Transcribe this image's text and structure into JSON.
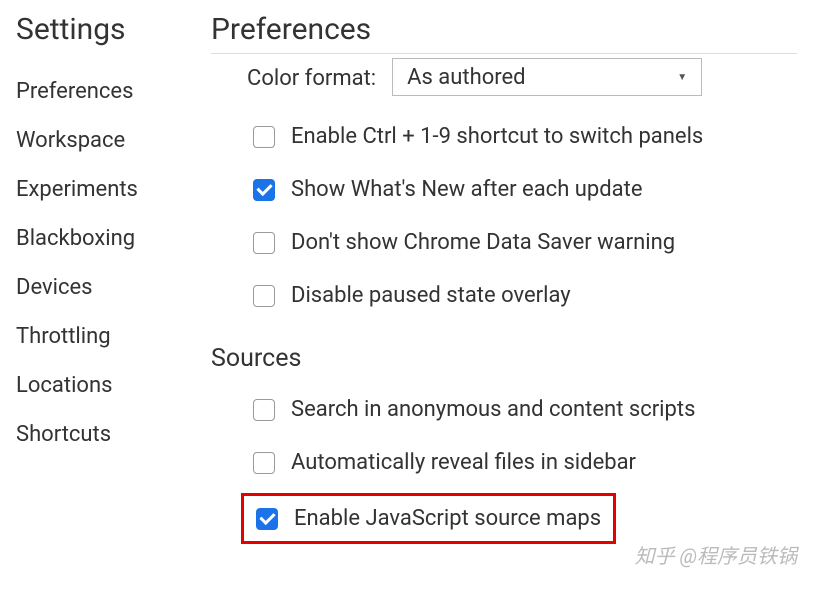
{
  "sidebar": {
    "title": "Settings",
    "items": [
      {
        "label": "Preferences"
      },
      {
        "label": "Workspace"
      },
      {
        "label": "Experiments"
      },
      {
        "label": "Blackboxing"
      },
      {
        "label": "Devices"
      },
      {
        "label": "Throttling"
      },
      {
        "label": "Locations"
      },
      {
        "label": "Shortcuts"
      }
    ]
  },
  "main": {
    "title": "Preferences",
    "colorFormat": {
      "label": "Color format:",
      "value": "As authored"
    },
    "appearance": {
      "checkboxes": [
        {
          "label": "Enable Ctrl + 1-9 shortcut to switch panels",
          "checked": false
        },
        {
          "label": "Show What's New after each update",
          "checked": true
        },
        {
          "label": "Don't show Chrome Data Saver warning",
          "checked": false
        },
        {
          "label": "Disable paused state overlay",
          "checked": false
        }
      ]
    },
    "sources": {
      "title": "Sources",
      "checkboxes": [
        {
          "label": "Search in anonymous and content scripts",
          "checked": false
        },
        {
          "label": "Automatically reveal files in sidebar",
          "checked": false
        },
        {
          "label": "Enable JavaScript source maps",
          "checked": true
        }
      ]
    }
  },
  "watermark": "知乎 @程序员铁锅"
}
